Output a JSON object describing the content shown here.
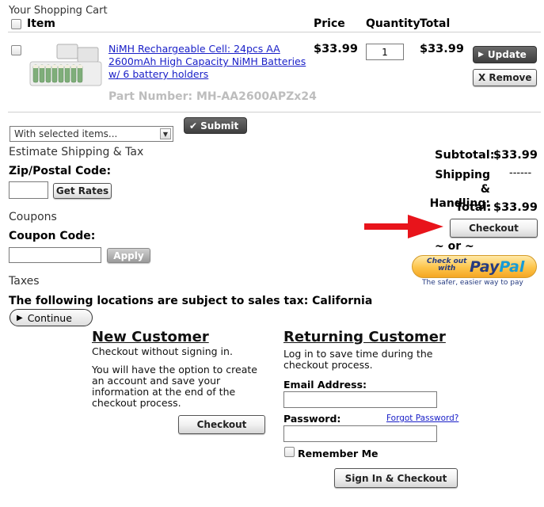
{
  "cart": {
    "title": "Your Shopping Cart",
    "columns": {
      "item": "Item",
      "price": "Price",
      "quantity": "Quantity",
      "total": "Total"
    },
    "product": {
      "name": "NiMH Rechargeable Cell: 24pcs AA 2600mAh High Capacity NiMH Batteries w/ 6 battery holders",
      "part_number": "Part Number: MH-AA2600APZx24",
      "price": "$33.99",
      "quantity": "1",
      "total": "$33.99"
    },
    "update_label": "Update",
    "remove_label": "X Remove"
  },
  "bulk": {
    "select_value": "With selected items...",
    "submit_label": "Submit"
  },
  "shipping": {
    "heading": "Estimate Shipping & Tax",
    "zip_label": "Zip/Postal Code:",
    "zip_value": "",
    "get_rates_label": "Get Rates"
  },
  "coupons": {
    "heading": "Coupons",
    "code_label": "Coupon Code:",
    "code_value": "",
    "apply_label": "Apply"
  },
  "taxes": {
    "heading": "Taxes",
    "notice": "The following locations are subject to sales tax: California",
    "continue_label": "Continue"
  },
  "summary": {
    "subtotal_label": "Subtotal:",
    "subtotal_value": "$33.99",
    "shipping_label_1": "Shipping &",
    "shipping_label_2": "Handling:",
    "shipping_value": "------",
    "total_label": "Total:",
    "total_value": "$33.99",
    "checkout_label": "Checkout",
    "or_label": "~ or ~",
    "paypal": {
      "checkout_small": "Check out",
      "with_small": "with",
      "brand_pay": "Pay",
      "brand_pal": "Pal",
      "tagline": "The safer, easier way to pay"
    },
    "colors": {
      "arrow": "#e8141b",
      "paypal_yellow": "#fdb940",
      "paypal_blue": "#253b80",
      "paypal_light_blue": "#179bd7"
    }
  },
  "new_customer": {
    "heading": "New Customer",
    "line1": "Checkout without signing in.",
    "para": [
      "You will have the option to create",
      "an account and save your",
      "information at the end of the",
      "checkout process."
    ],
    "checkout_label": "Checkout"
  },
  "returning_customer": {
    "heading": "Returning Customer",
    "para": [
      "Log in to save time during the",
      "checkout process."
    ],
    "email_label": "Email Address:",
    "email_value": "",
    "password_label": "Password:",
    "password_value": "",
    "forgot_label": "Forgot Password?",
    "remember_label": "Remember Me",
    "signin_label": "Sign In & Checkout"
  }
}
